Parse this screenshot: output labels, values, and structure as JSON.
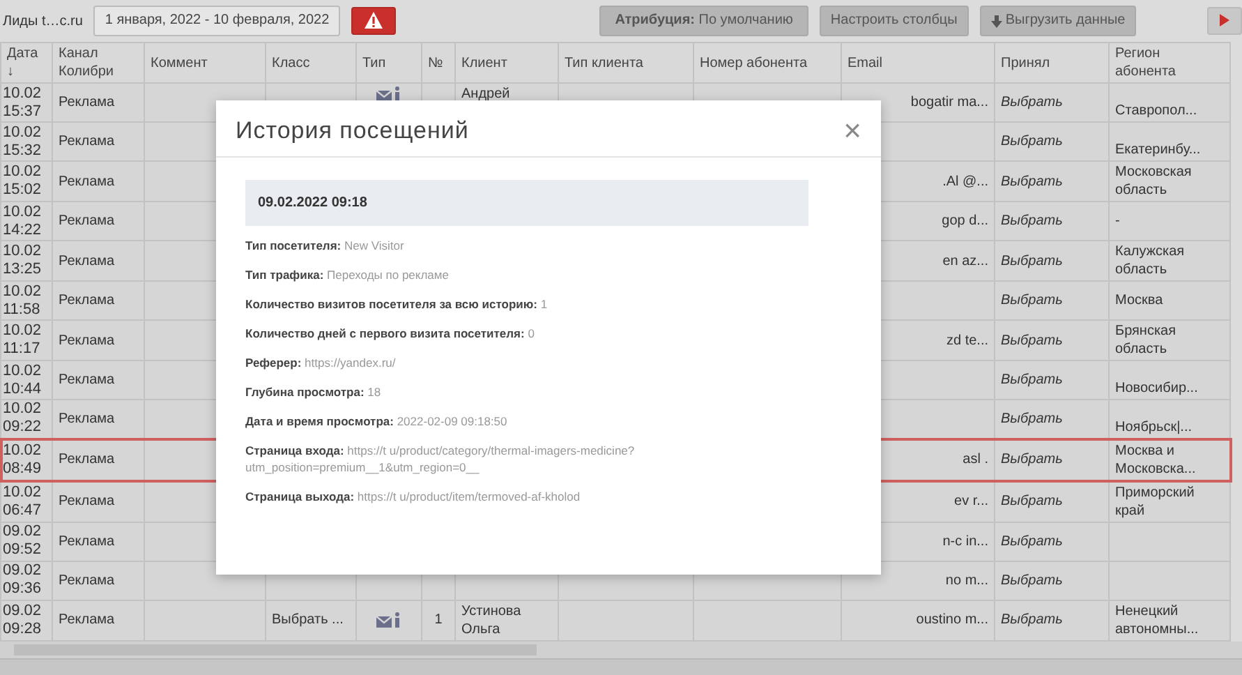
{
  "toolbar": {
    "title": "Лиды t…c.ru",
    "date_range": "1 января, 2022 - 10 февраля, 2022",
    "attribution": "**Атрибуция:** По умолчанию",
    "columns_button": "Настроить столбцы",
    "export_button": "Выгрузить данные"
  },
  "table": {
    "columns": [
      "Дата ↓",
      "Канал Колибри",
      "Коммент",
      "Класс",
      "Тип",
      "№",
      "Клиент",
      "Тип клиента",
      "Номер абонента",
      "Email",
      "Принял",
      "Регион абонента"
    ],
    "rows": [
      {
        "date": "10.02",
        "time": "15:37",
        "channel": "Реклама",
        "client": "Андрей",
        "email": "bogatir ma...",
        "accepted": "Выбрать",
        "region": "Ставропол...",
        "highlighted": false
      },
      {
        "date": "10.02",
        "time": "15:32",
        "channel": "Реклама",
        "accepted": "Выбрать",
        "region": "Екатеринбу...",
        "highlighted": false
      },
      {
        "date": "10.02",
        "time": "15:02",
        "channel": "Реклама",
        "email": ".Al @...",
        "accepted": "Выбрать",
        "region": "Московская область",
        "highlighted": false
      },
      {
        "date": "10.02",
        "time": "14:22",
        "channel": "Реклама",
        "email": "gop d...",
        "accepted": "Выбрать",
        "region": "-",
        "highlighted": false
      },
      {
        "date": "10.02",
        "time": "13:25",
        "channel": "Реклама",
        "email": "en az...",
        "accepted": "Выбрать",
        "region": "Калужская область",
        "highlighted": false
      },
      {
        "date": "10.02",
        "time": "11:58",
        "channel": "Реклама",
        "accepted": "Выбрать",
        "region": "Москва",
        "highlighted": false
      },
      {
        "date": "10.02",
        "time": "11:17",
        "channel": "Реклама",
        "email": "zd te...",
        "accepted": "Выбрать",
        "region": "Брянская область",
        "highlighted": false
      },
      {
        "date": "10.02",
        "time": "10:44",
        "channel": "Реклама",
        "accepted": "Выбрать",
        "region": "Новосибир...",
        "highlighted": false
      },
      {
        "date": "10.02",
        "time": "09:22",
        "channel": "Реклама",
        "accepted": "Выбрать",
        "region": "Ноябрьск|...",
        "highlighted": false
      },
      {
        "date": "10.02",
        "time": "08:49",
        "channel": "Реклама",
        "email": "asl .",
        "accepted": "Выбрать",
        "region": "Москва и Московска...",
        "highlighted": true
      },
      {
        "date": "10.02",
        "time": "06:47",
        "channel": "Реклама",
        "email": "ev r...",
        "accepted": "Выбрать",
        "region": "Приморский край",
        "highlighted": false
      },
      {
        "date": "09.02",
        "time": "09:52",
        "channel": "Реклама",
        "email": "n-c in...",
        "accepted": "Выбрать",
        "highlighted": false
      },
      {
        "date": "09.02",
        "time": "09:36",
        "channel": "Реклама",
        "email": "no m...",
        "accepted": "Выбрать",
        "highlighted": false
      },
      {
        "date": "09.02",
        "time": "09:28",
        "channel": "Реклама",
        "klass": "Выбрать ...",
        "number": "1",
        "client": "Устинова Ольга",
        "email": "oustino m...",
        "accepted": "Выбрать",
        "region": "Ненецкий автономны...",
        "highlighted": false
      }
    ]
  },
  "modal": {
    "title": "История посещений",
    "close": "×",
    "visit_date": "09.02.2022 09:18",
    "fields": [
      {
        "label": "Тип посетителя:",
        "value": "New Visitor"
      },
      {
        "label": "Тип трафика:",
        "value": "Переходы по рекламе"
      },
      {
        "label": "Количество визитов посетителя за всю историю:",
        "value": "1"
      },
      {
        "label": "Количество дней с первого визита посетителя:",
        "value": "0"
      },
      {
        "label": "Реферер:",
        "value": "https://yandex.ru/"
      },
      {
        "label": "Глубина просмотра:",
        "value": "18"
      },
      {
        "label": "Дата и время просмотра:",
        "value": "2022-02-09 09:18:50"
      },
      {
        "label": "Страница входа:",
        "value": "https://t u/product/category/thermal-imagers-medicine? utm_position=premium__1&utm_region=0__"
      },
      {
        "label": "Страница выхода:",
        "value": "https://t u/product/item/termoved-af-kholod"
      }
    ]
  }
}
